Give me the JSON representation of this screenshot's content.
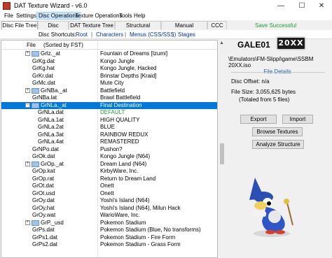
{
  "window": {
    "title": "DAT Texture Wizard - v6.0",
    "min_glyph": "—",
    "max_glyph": "☐",
    "close_glyph": "✕"
  },
  "menu": [
    "File",
    "Settings",
    "Disc Operations",
    "Texture Operations",
    "Tools",
    "Help"
  ],
  "tabs": [
    "Disc File Tree",
    "Disc Details",
    "DAT Texture Tree",
    "Structural Analysis",
    "Manual Placement",
    "CCC"
  ],
  "status": "Save Successful",
  "shortcuts": {
    "label": "Disc Shortcuts:",
    "items": [
      "Root",
      "Characters",
      "Menus (CSS/SSS)",
      "Stages"
    ],
    "sep": "|"
  },
  "tree": {
    "col_file": "File",
    "col_sorted": "(Sorted by FST)",
    "rows": [
      {
        "name": "Grlz._at",
        "desc": "Fountain of Dreams [Izumi]",
        "type": "folder",
        "indent": 0,
        "expander": "+"
      },
      {
        "name": "GrKg.dat",
        "desc": "Kongo Jungle",
        "type": "file",
        "indent": 0
      },
      {
        "name": "GrKg.hat",
        "desc": "Kongo Jungle, Hacked",
        "type": "file",
        "indent": 0
      },
      {
        "name": "GrKr.dat",
        "desc": "Brinstar Depths [Kraid]",
        "type": "file",
        "indent": 0
      },
      {
        "name": "GrMc.dat",
        "desc": "Mute City",
        "type": "file",
        "indent": 0
      },
      {
        "name": "GrNBa._at",
        "desc": "Battlefield",
        "type": "folder",
        "indent": 0,
        "expander": "+"
      },
      {
        "name": "GrNBa.lat",
        "desc": "Brawl Battlefield",
        "type": "file",
        "indent": 0
      },
      {
        "name": "GrNLa._at",
        "desc": "Final Destination",
        "type": "folder",
        "indent": 0,
        "expander": "−",
        "selected": true
      },
      {
        "name": "GrNLa.dat",
        "desc": "DEFAULT",
        "type": "file",
        "indent": 1,
        "green": true
      },
      {
        "name": "GrNLa.1at",
        "desc": "HIGH QUALITY",
        "type": "file",
        "indent": 1
      },
      {
        "name": "GrNLa.2at",
        "desc": "BLUE",
        "type": "file",
        "indent": 1
      },
      {
        "name": "GrNLa.3at",
        "desc": "RAINBOW REDUX",
        "type": "file",
        "indent": 1
      },
      {
        "name": "GrNLa.4at",
        "desc": "REMASTERED",
        "type": "file",
        "indent": 1
      },
      {
        "name": "GrNPo.dat",
        "desc": "Pushon?",
        "type": "file",
        "indent": 0
      },
      {
        "name": "GrOk.dat",
        "desc": "Kongo Jungle (N64)",
        "type": "file",
        "indent": 0
      },
      {
        "name": "GrOp._at",
        "desc": "Dream Land (N64)",
        "type": "folder",
        "indent": 0,
        "expander": "+"
      },
      {
        "name": "GrOp.kat",
        "desc": "KirbyWare, Inc.",
        "type": "file",
        "indent": 0
      },
      {
        "name": "GrOp.rat",
        "desc": "Return to Dream Land",
        "type": "file",
        "indent": 0
      },
      {
        "name": "GrOt.dat",
        "desc": "Onett",
        "type": "file",
        "indent": 0
      },
      {
        "name": "GrOt.usd",
        "desc": "Onett",
        "type": "file",
        "indent": 0
      },
      {
        "name": "GrOy.dat",
        "desc": "Yoshi's Island (N64)",
        "type": "file",
        "indent": 0
      },
      {
        "name": "GrOy.hat",
        "desc": "Yoshi's Island (N64), Milun Hack",
        "type": "file",
        "indent": 0
      },
      {
        "name": "GrOy.wat",
        "desc": "WarioWare, Inc.",
        "type": "file",
        "indent": 0
      },
      {
        "name": "GrP._usd",
        "desc": "Pokemon Stadium",
        "type": "folder",
        "indent": 0,
        "expander": "+"
      },
      {
        "name": "GrPs.dat",
        "desc": "Pokemon Stadium (Blue, No transforms)",
        "type": "file",
        "indent": 0
      },
      {
        "name": "GrPs1.dat",
        "desc": "Pokemon Stadium - Fire Form",
        "type": "file",
        "indent": 0
      },
      {
        "name": "GrPs2.dat",
        "desc": "Pokemon Stadium - Grass Form",
        "type": "file",
        "indent": 0
      }
    ]
  },
  "scroll": {
    "up_glyph": "▲"
  },
  "game": {
    "id": "GALE01",
    "logo": "20XX",
    "iso_path": "\\Emulators\\FM-Slippi\\game\\SSBM 20XX.iso"
  },
  "file_details": {
    "heading": "File Details",
    "offset": "Disc Offset: n/a",
    "size": "File Size: 3,055,625 bytes",
    "total": "(Totaled from 5 files)"
  },
  "buttons": {
    "export": "Export",
    "import": "Import",
    "browse": "Browse Textures",
    "analyze": "Analyze Structure"
  }
}
